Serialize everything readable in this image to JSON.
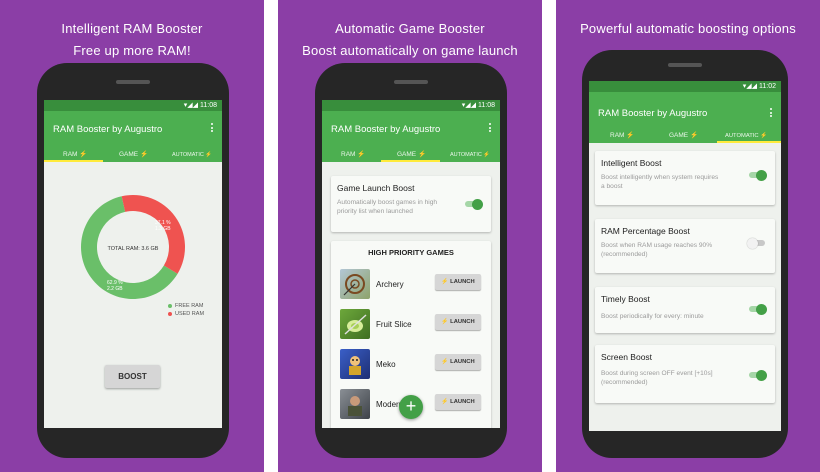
{
  "colors": {
    "background": "#8b3ea6",
    "appbar": "#4caf50",
    "statusbar": "#388e3c",
    "free_ram": "#6abf69",
    "used_ram": "#ef5350",
    "accent": "#43a047",
    "tab_indicator": "#ffeb3b"
  },
  "status": {
    "time": "11:08",
    "time_3": "11:02"
  },
  "app": {
    "title": "RAM Booster by Augustro"
  },
  "tabs": [
    {
      "label": "RAM",
      "icon": "lightning-bolt-icon"
    },
    {
      "label": "GAME",
      "icon": "lightning-bolt-icon"
    },
    {
      "label": "AUTOMATIC",
      "icon": "lightning-bolt-icon"
    }
  ],
  "screens": [
    {
      "caption": [
        "Intelligent RAM Booster",
        "Free up more RAM!"
      ],
      "ram": {
        "total_label": "TOTAL RAM: 3.6 GB",
        "used_percent": 37.1,
        "used_percent_label": "37.1 %",
        "used_gb": "1.3 GB",
        "free_percent_label": "62.9 %",
        "free_gb": "2.2 GB",
        "legend": [
          "FREE RAM",
          "USED RAM"
        ]
      },
      "boost_button": "BOOST"
    },
    {
      "caption": [
        "Automatic Game Booster",
        "Boost automatically on game launch"
      ],
      "launch_boost": {
        "title": "Game Launch Boost",
        "description": "Automatically boost games in high priority list when launched",
        "enabled": true
      },
      "priority_header": "HIGH PRIORITY GAMES",
      "games": [
        {
          "name": "Archery",
          "action": "LAUNCH",
          "icon": "archery-game-icon"
        },
        {
          "name": "Fruit Slice",
          "action": "LAUNCH",
          "icon": "fruit-slice-game-icon"
        },
        {
          "name": "Meko",
          "action": "LAUNCH",
          "icon": "meko-game-icon"
        },
        {
          "name": "Modern",
          "action": "LAUNCH",
          "icon": "modern-game-icon"
        }
      ],
      "fab": "+"
    },
    {
      "caption": [
        "Powerful automatic boosting options"
      ],
      "options": [
        {
          "title": "Intelligent Boost",
          "description": "Boost intelligently when system requires a boost",
          "enabled": true
        },
        {
          "title": "RAM Percentage Boost",
          "description": "Boost when RAM usage reaches 90% (recommended)",
          "enabled": false
        },
        {
          "title": "Timely Boost",
          "description": "Boost periodically for every: minute",
          "enabled": true
        },
        {
          "title": "Screen Boost",
          "description": "Boost during screen OFF event [+10s] (recommended)",
          "enabled": true
        }
      ]
    }
  ]
}
